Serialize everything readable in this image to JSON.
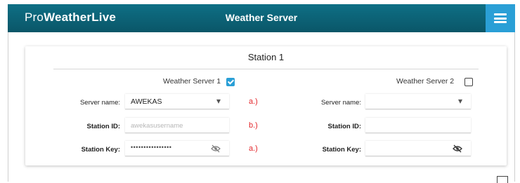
{
  "header": {
    "logo_prefix": "Pro",
    "logo_bold": "WeatherLive",
    "title": "Weather Server",
    "menu_icon": "hamburger-icon",
    "bg_color": "#0a5f72",
    "menu_bg_color": "#2a9fd6"
  },
  "card": {
    "title": "Station 1"
  },
  "server1": {
    "label": "Weather Server 1",
    "checked": true,
    "name_label": "Server name:",
    "name_value": "AWEKAS",
    "id_label": "Station ID:",
    "id_placeholder": "awekasusername",
    "key_label": "Station Key:",
    "key_value": "••••••••••••••••"
  },
  "server2": {
    "label": "Weather Server 2",
    "checked": false,
    "name_label": "Server name:",
    "name_value": "",
    "id_label": "Station ID:",
    "id_value": "",
    "key_label": "Station Key:",
    "key_value": ""
  },
  "notes": {
    "a1": "a.)",
    "b": "b.)",
    "a2": "a.)",
    "color": "#e3262b"
  }
}
